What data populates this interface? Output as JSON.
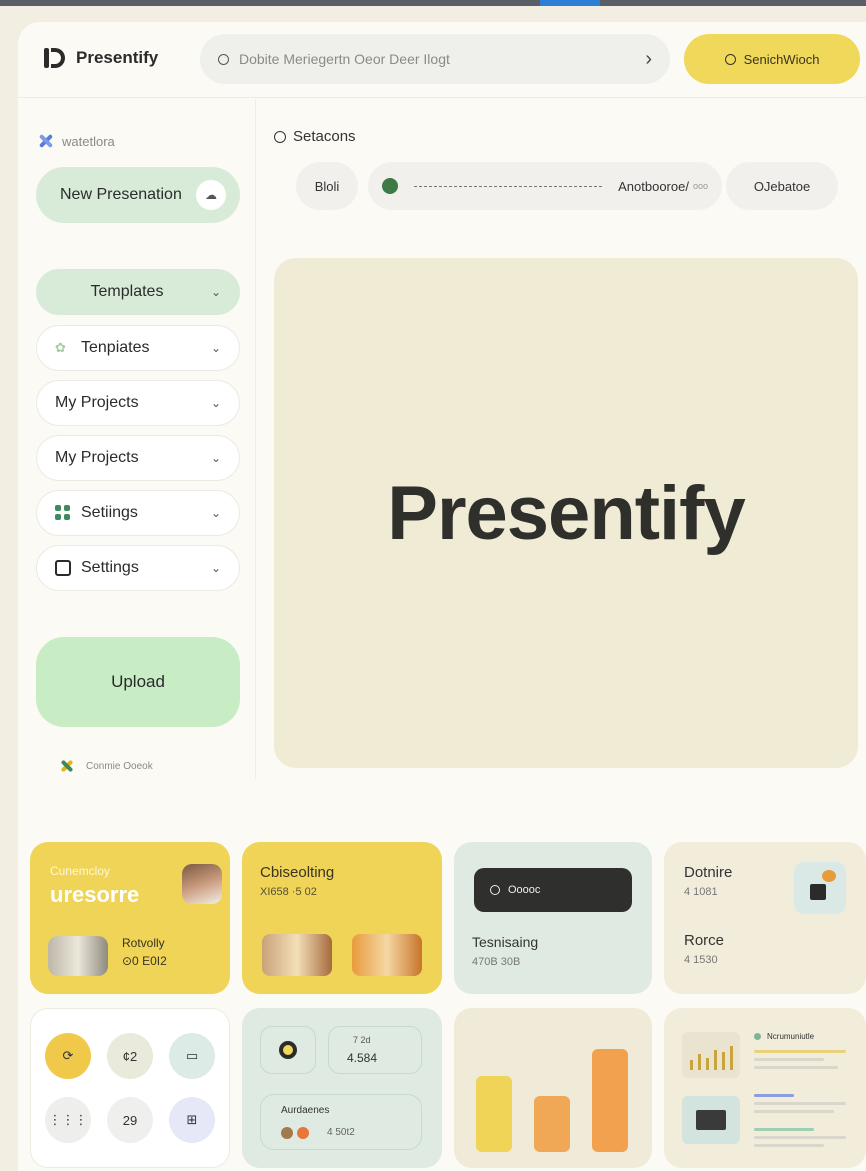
{
  "colors": {
    "accent_yellow": "#f0d85a",
    "accent_green": "#d8ebd8",
    "upload_green": "#c8ecc4",
    "hero_bg": "#f0ebd5",
    "page_bg": "#f2efe2"
  },
  "header": {
    "logo_text": "Presentify",
    "search_placeholder": "Dobite Meriegertn Oeor Deer Ilogt",
    "search_button": "SenichWioch"
  },
  "sidebar": {
    "brand": "watetlora",
    "new_presentation": "New Presenation",
    "items": [
      {
        "label": "Templates",
        "icon": "none",
        "active": true
      },
      {
        "label": "Tenpiates",
        "icon": "leaf-icon",
        "active": false
      },
      {
        "label": "My Projects",
        "icon": "none",
        "active": false
      },
      {
        "label": "My Projects",
        "icon": "none",
        "active": false
      },
      {
        "label": "Setiings",
        "icon": "grid-icon",
        "active": false
      },
      {
        "label": "Settings",
        "icon": "frame-icon",
        "active": false
      }
    ],
    "upload": "Upload",
    "footer": "Conmie Ooeok"
  },
  "main": {
    "sections_title": "Setacons",
    "chips": [
      "Bloli",
      "Anotbooroe/",
      "OJebatoe"
    ],
    "chip_extra": "ooo",
    "hero_title": "Presentify"
  },
  "cards": {
    "c1": {
      "label": "Cunemcloy",
      "title": "uresorre",
      "sub": "Rotvolly",
      "value": "⊙0 E0I2"
    },
    "c2": {
      "title": "Cbiseolting",
      "sub": "XI658 ·5 02"
    },
    "c3": {
      "pill": "Ooooc",
      "title": "Tesnisaing",
      "sub": "470B 30B"
    },
    "c4": {
      "title1": "Dotnire",
      "sub1": "4 1081",
      "title2": "Rorce",
      "sub2": "4 1530"
    },
    "c5": {
      "circle_values": [
        "",
        "¢2",
        "",
        "",
        "29",
        ""
      ]
    },
    "c6": {
      "stat_label": "7 2d",
      "stat_value": "4.584",
      "box_label": "Aurdaenes",
      "box_value": "4 50t2"
    },
    "c7": {
      "bars": [
        {
          "value": 0.7,
          "color": "#efd457"
        },
        {
          "value": 0.52,
          "color": "#f0a756"
        },
        {
          "value": 0.95,
          "color": "#f2a14e"
        }
      ]
    },
    "c8": {
      "heading": "Ncrumuniutle"
    }
  }
}
